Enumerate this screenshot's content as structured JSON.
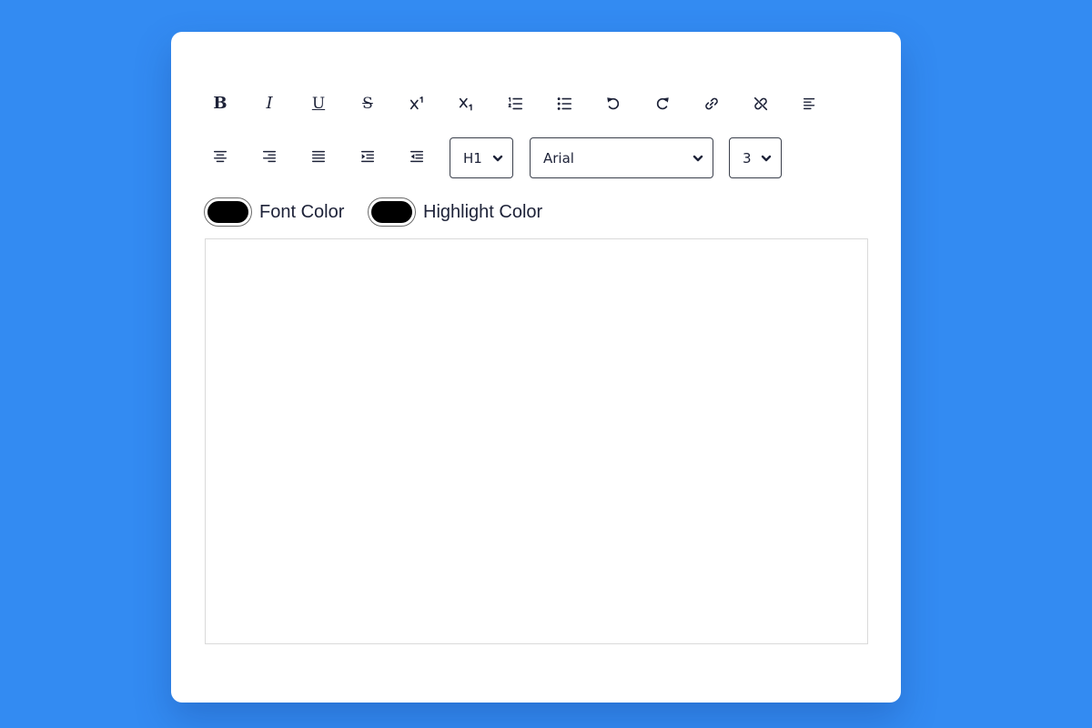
{
  "toolbar": {
    "buttons": [
      {
        "name": "bold",
        "icon": "bold-icon"
      },
      {
        "name": "italic",
        "icon": "italic-icon"
      },
      {
        "name": "underline",
        "icon": "underline-icon"
      },
      {
        "name": "strikethrough",
        "icon": "strikethrough-icon"
      },
      {
        "name": "superscript",
        "icon": "superscript-icon"
      },
      {
        "name": "subscript",
        "icon": "subscript-icon"
      },
      {
        "name": "ordered-list",
        "icon": "ordered-list-icon"
      },
      {
        "name": "unordered-list",
        "icon": "unordered-list-icon"
      },
      {
        "name": "undo",
        "icon": "undo-icon"
      },
      {
        "name": "redo",
        "icon": "redo-icon"
      },
      {
        "name": "link",
        "icon": "link-icon"
      },
      {
        "name": "unlink",
        "icon": "unlink-icon"
      },
      {
        "name": "align-left",
        "icon": "align-left-icon"
      },
      {
        "name": "align-center",
        "icon": "align-center-icon"
      },
      {
        "name": "align-right",
        "icon": "align-right-icon"
      },
      {
        "name": "justify",
        "icon": "justify-icon"
      },
      {
        "name": "indent",
        "icon": "indent-icon"
      },
      {
        "name": "outdent",
        "icon": "outdent-icon"
      }
    ],
    "glyphs": {
      "bold": "B",
      "italic": "I",
      "underline": "U",
      "strikethrough": "S"
    },
    "heading_select": {
      "value": "H1"
    },
    "font_select": {
      "value": "Arial"
    },
    "size_select": {
      "value": "3"
    }
  },
  "colors": {
    "font_color": {
      "label": "Font Color",
      "value": "#000000"
    },
    "highlight_color": {
      "label": "Highlight Color",
      "value": "#000000"
    }
  },
  "theme": {
    "background": "#338bf2",
    "card": "#ffffff",
    "icon": "#1d2238"
  },
  "editor": {
    "content": ""
  }
}
